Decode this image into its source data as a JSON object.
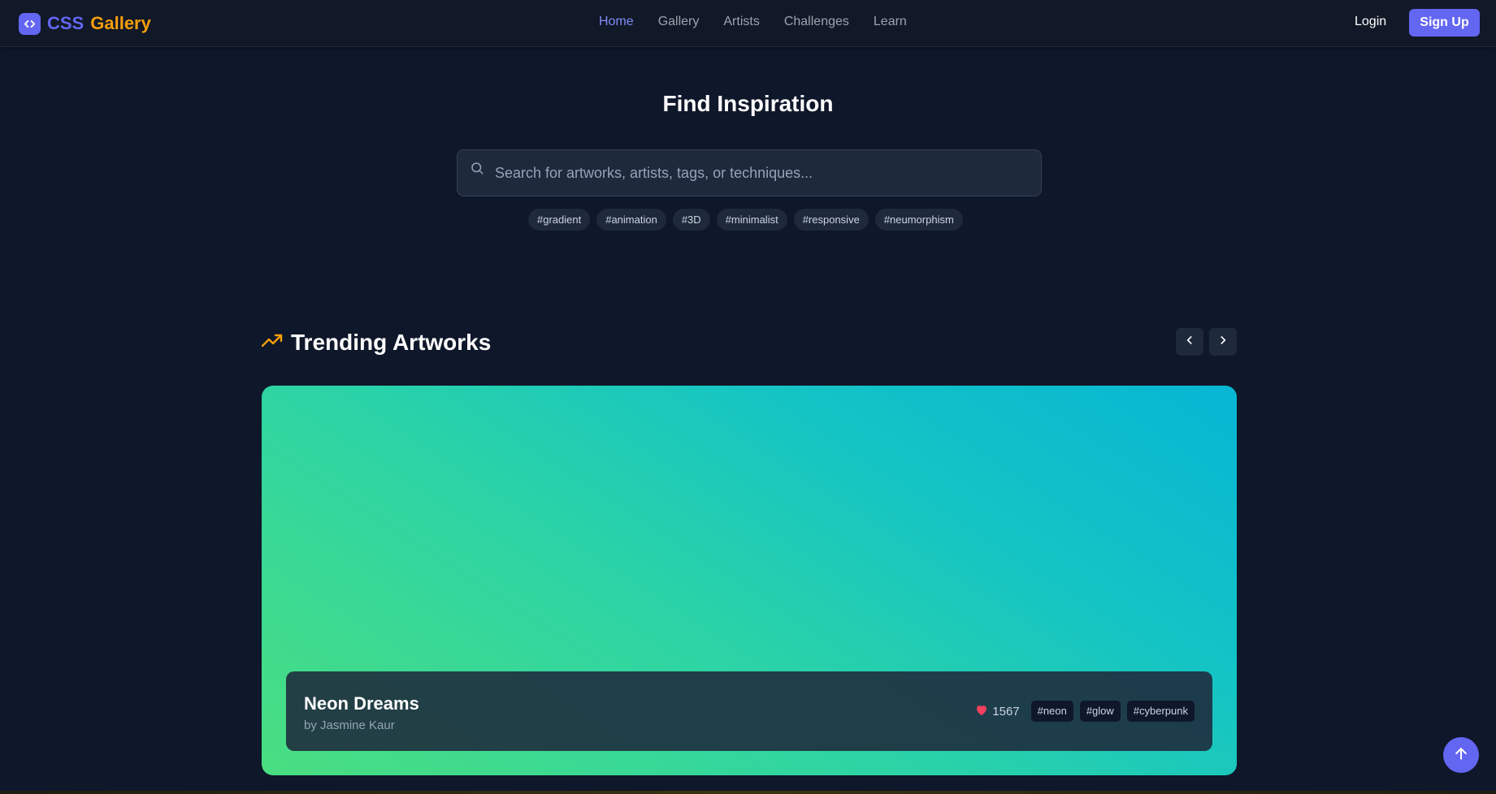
{
  "brand": {
    "part1": "CSS",
    "part2": "Gallery",
    "icon": "code-icon"
  },
  "nav": {
    "links": [
      {
        "label": "Home",
        "active": true
      },
      {
        "label": "Gallery",
        "active": false
      },
      {
        "label": "Artists",
        "active": false
      },
      {
        "label": "Challenges",
        "active": false
      },
      {
        "label": "Learn",
        "active": false
      }
    ],
    "login": "Login",
    "signup": "Sign Up"
  },
  "hero": {
    "title": "Find Inspiration",
    "search_placeholder": "Search for artworks, artists, tags, or techniques...",
    "search_value": "",
    "tags": [
      "#gradient",
      "#animation",
      "#3D",
      "#minimalist",
      "#responsive",
      "#neumorphism"
    ]
  },
  "trending": {
    "title": "Trending Artworks",
    "icon": "trending-up-icon",
    "artwork": {
      "title": "Neon Dreams",
      "artist": "by Jasmine Kaur",
      "likes": "1567",
      "tags": [
        "#neon",
        "#glow",
        "#cyberpunk"
      ]
    }
  },
  "colors": {
    "background": "#0f172a",
    "accent": "#6366f1",
    "brand_secondary": "#f59e0b",
    "like": "#f43f5e"
  }
}
